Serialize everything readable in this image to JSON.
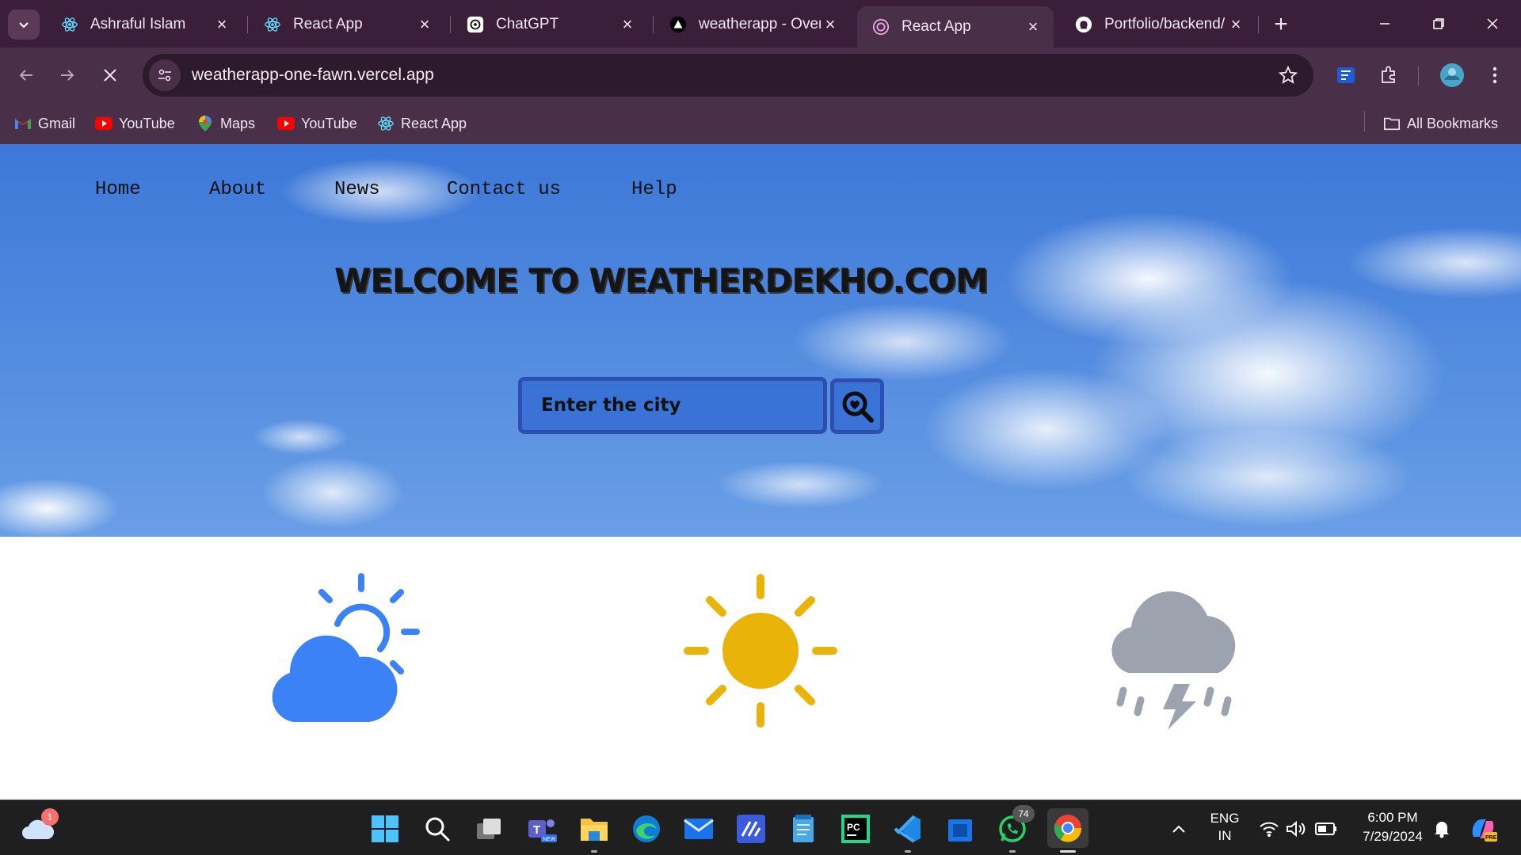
{
  "browser": {
    "tabs": [
      {
        "title": "Ashraful Islam",
        "icon": "react-icon",
        "active": false
      },
      {
        "title": "React App",
        "icon": "react-icon",
        "active": false
      },
      {
        "title": "ChatGPT",
        "icon": "chatgpt-icon",
        "active": false
      },
      {
        "title": "weatherapp - Over",
        "icon": "vercel-icon",
        "active": false
      },
      {
        "title": "React App",
        "icon": "react-icon",
        "active": true
      },
      {
        "title": "Portfolio/backend/",
        "icon": "github-icon",
        "active": false
      }
    ],
    "url": "weatherapp-one-fawn.vercel.app",
    "bookmarks": [
      {
        "label": "Gmail",
        "icon": "gmail-icon"
      },
      {
        "label": "YouTube",
        "icon": "youtube-icon"
      },
      {
        "label": "Maps",
        "icon": "maps-icon"
      },
      {
        "label": "YouTube",
        "icon": "youtube-icon"
      },
      {
        "label": "React App",
        "icon": "react-icon"
      }
    ],
    "all_bookmarks_label": "All Bookmarks",
    "colors": {
      "frame": "#3b1f3a",
      "toolbar": "#4a2f48",
      "omnibox": "#2e1a2d"
    }
  },
  "page": {
    "nav": [
      "Home",
      "About",
      "News",
      "Contact us",
      "Help"
    ],
    "heading": "WELCOME TO WEATHERDEKHO.COM",
    "search": {
      "placeholder": "Enter the city",
      "value": ""
    },
    "weather_icons": [
      "partly-cloudy-icon",
      "sun-icon",
      "thunderstorm-icon"
    ],
    "colors": {
      "accent": "#2f4fb0",
      "partly_cloudy": "#3b82f6",
      "sun": "#eab308",
      "storm": "#9ca3af"
    }
  },
  "taskbar": {
    "weather_badge": "1",
    "whatsapp_badge": "74",
    "language": {
      "line1": "ENG",
      "line2": "IN"
    },
    "time": "6:00 PM",
    "date": "7/29/2024"
  }
}
